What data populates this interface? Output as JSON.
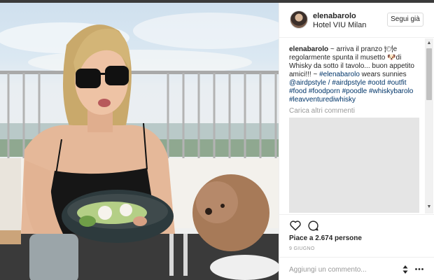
{
  "post": {
    "username": "elenabarolo",
    "location": "Hotel VIU Milan",
    "follow_label": "Segui già",
    "caption": {
      "user": "elenabarolo",
      "text": " ~ arriva il pranzo 🍽e regolarmente spunta il musetto 🐶di Whisky da sotto il tavolo... buon appetito amici!!! ~ ",
      "mention1": "#elenabarolo",
      "text2": " wears sunnies ",
      "mention2": "@airdpstyle / #airdpstyle #ootd #outfit #food #foodporn #poodle #whiskybarolo #leavventurediwhisky"
    },
    "load_more": "Carica altri commenti",
    "likes": "Piace a 2.674 persone",
    "date": "9 GIUGNO",
    "comment_placeholder": "Aggiungi un commento..."
  },
  "icons": {
    "avatar": "avatar",
    "like": "heart-icon",
    "comment": "comment-icon",
    "options": "more-icon",
    "stepper": "stepper-icon"
  },
  "colors": {
    "link": "#003569",
    "muted": "#999999",
    "border": "#efefef"
  }
}
